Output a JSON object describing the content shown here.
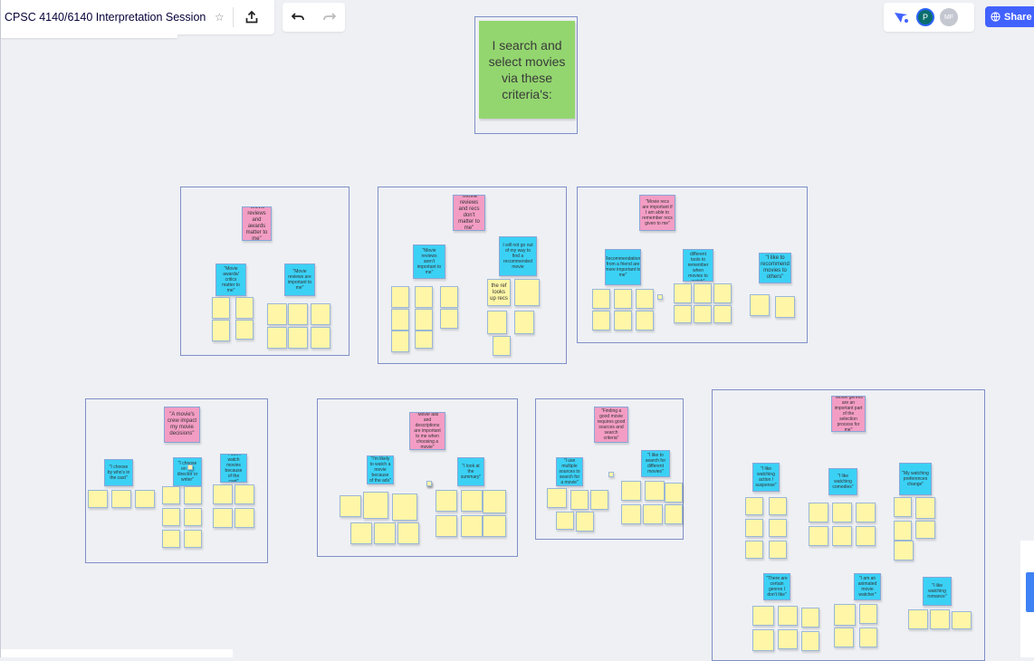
{
  "header": {
    "board_title": "CPSC 4140/6140 Interpretation Session",
    "share_label": "Share",
    "avatars": [
      "P",
      "MF"
    ],
    "icons": [
      "star-icon",
      "export-icon",
      "undo-icon",
      "redo-icon",
      "reactions-icon",
      "globe-icon"
    ]
  },
  "colors": {
    "canvas": "#eef0f4",
    "frame_border": "#7f8fc7",
    "yellow": "#fff6a8",
    "blue": "#3bd1f5",
    "pink": "#f39dc4",
    "green": "#93d66f",
    "accent": "#4262ff"
  },
  "root_note": "I search and select movies via these criteria's:",
  "frames": {
    "f1": {
      "pink": "\"Movie reviews and awards matter to me\"",
      "blue": [
        "\"Movie awards/ critics matter to me\"",
        "\"Movie reviews are important to me\""
      ],
      "yellow": [
        "",
        "",
        "",
        "",
        "",
        "",
        "",
        "",
        "",
        ""
      ]
    },
    "f2": {
      "pink": "\"Movie reviews and recs don't matter to me\"",
      "blue": [
        "\"Movie reviews aren't important to me\"",
        "I will not go out of my way to find a recommended movie"
      ],
      "yellow": [
        "",
        "",
        "",
        "",
        "",
        "",
        "",
        "",
        "the ref looks up recs",
        "",
        "",
        "",
        ""
      ]
    },
    "f3": {
      "pink": "\"Movie recs are important if I am able to remember recs given to me\"",
      "blue": [
        "\"Recommendations from a friend are more important to me\"",
        "\"I use different tools to remember when movies to watch\"",
        "\"I like to recommend movies to others\""
      ],
      "yellow": [
        "",
        "",
        "",
        "",
        "",
        "",
        "",
        "",
        "",
        "",
        "",
        "",
        "",
        "",
        ""
      ]
    },
    "f4": {
      "pink": "\"A movie's crew impact my movie decisions\"",
      "blue": [
        "\"I choose by who's in the cast\"",
        "\"I choose on the director or writer\"",
        "\"I don't watch movies because of the cast\""
      ],
      "yellow": [
        "",
        "",
        "",
        "",
        "",
        "",
        "",
        "",
        "",
        "",
        "",
        "",
        "",
        "",
        ""
      ]
    },
    "f5": {
      "pink": "\"Movie ads and descriptions are important to me when choosing a movie\"",
      "blue": [
        "\"I'm likely to watch a movie because of the ads\"",
        "\"I look at the summary\""
      ],
      "yellow": [
        "",
        "",
        "",
        "",
        "",
        "",
        "",
        "",
        "",
        "",
        "",
        "",
        "",
        "",
        ""
      ]
    },
    "f6": {
      "pink": "\"Finding a good movie requires good sources and search criteria\"",
      "blue": [
        "\"I use multiple sources to search for a movie\"",
        "\"I like to search for different movies\""
      ],
      "yellow": [
        "",
        "",
        "",
        "",
        "",
        "",
        "",
        "",
        "",
        "",
        "",
        ""
      ]
    },
    "f7": {
      "pink": "\"Movie genres are an important part of the selection process for me\"",
      "blue": [
        "\"I like watching action / suspense\"",
        "\"I like watching comedies\"",
        "\"My watching preferences change\"",
        "\"There are certain genres I don't like\"",
        "\"I am an animated movie watcher\"",
        "\"I like watching romance\""
      ],
      "yellow": [
        "",
        "",
        "",
        "",
        "",
        "",
        "",
        "",
        "",
        "",
        "",
        "",
        "",
        "",
        "",
        "",
        "",
        "",
        "",
        "",
        "",
        "",
        "",
        "",
        "",
        "",
        "",
        "",
        "",
        ""
      ]
    }
  }
}
